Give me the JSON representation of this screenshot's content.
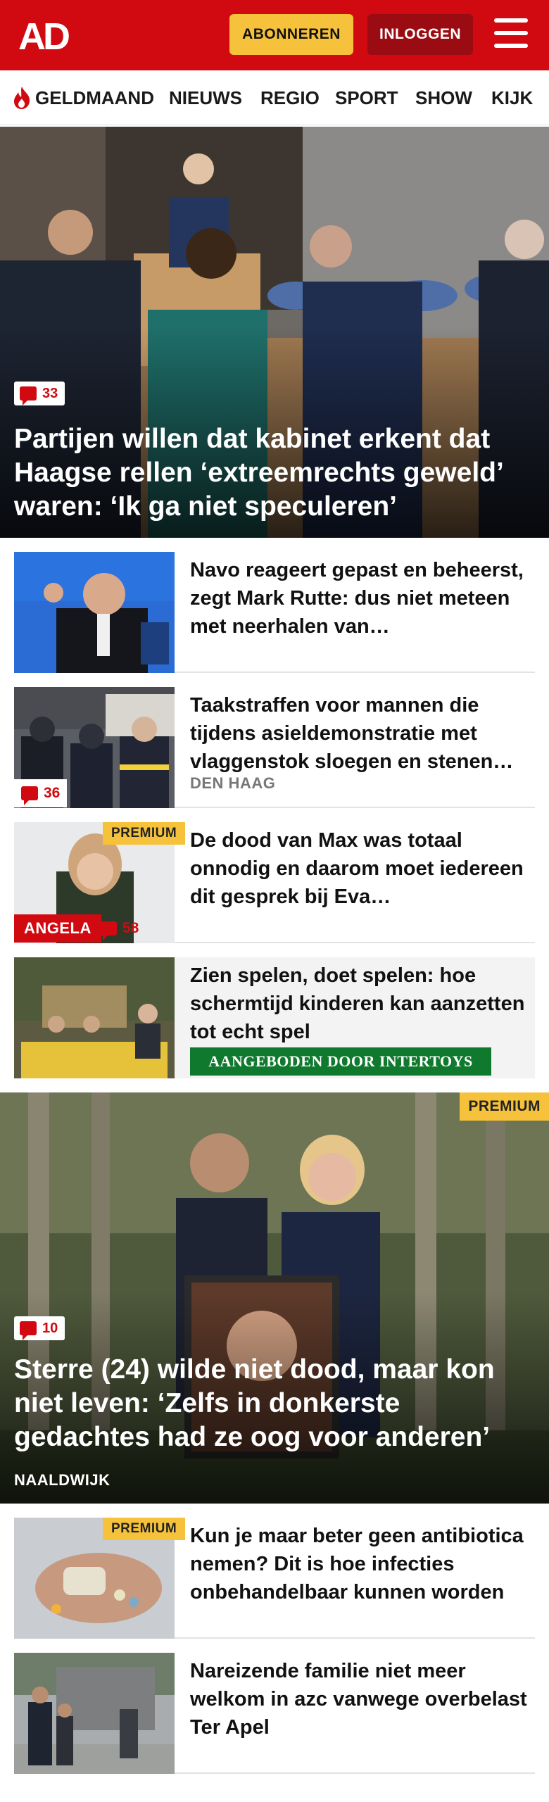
{
  "header": {
    "logo_text": "AD",
    "subscribe_label": "ABONNEREN",
    "login_label": "INLOGGEN",
    "colors": {
      "brand": "#d10a11",
      "subscribe": "#f6c23b",
      "login": "#9a0c12"
    }
  },
  "nav": {
    "items": [
      "GELDMAAND",
      "NIEUWS",
      "REGIO",
      "SPORT",
      "SHOW",
      "KIJK"
    ],
    "first_item_icon": "flame-icon"
  },
  "hero1": {
    "comments": "33",
    "title": "Partijen willen dat kabinet erkent dat Haagse rellen ‘extreemrechts geweld’ waren: ‘Ik ga niet speculeren’"
  },
  "articles": [
    {
      "title": "Navo reageert gepast en beheerst, zegt Mark Rutte: dus niet meteen met neerhalen van…"
    },
    {
      "title": "Taakstraffen voor mannen die tijdens asieldemonstratie met vlaggenstok sloegen en stenen…",
      "comments": "36",
      "location": "DEN HAAG"
    },
    {
      "title": "De dood van Max was totaal onnodig en daarom moet iedereen dit gesprek bij Eva…",
      "premium": "PREMIUM",
      "tag": "ANGELA",
      "comments": "58"
    },
    {
      "title": "Zien spelen, doet spelen: hoe schermtijd kinderen kan aanzetten tot echt spel",
      "sponsor": "AANGEBODEN DOOR INTERTOYS"
    }
  ],
  "hero2": {
    "premium": "PREMIUM",
    "comments": "10",
    "title": "Sterre (24) wilde niet dood, maar kon niet leven: ‘Zelfs in donkerste gedachtes had ze oog voor anderen’",
    "location": "NAALDWIJK"
  },
  "articles2": [
    {
      "title": "Kun je maar beter geen antibioti­ca nemen? Dit is hoe infecties onbehandelbaar kunnen worden",
      "premium": "PREMIUM"
    },
    {
      "title": "Nareizende familie niet meer welkom in azc vanwege overbelast Ter Apel"
    }
  ]
}
